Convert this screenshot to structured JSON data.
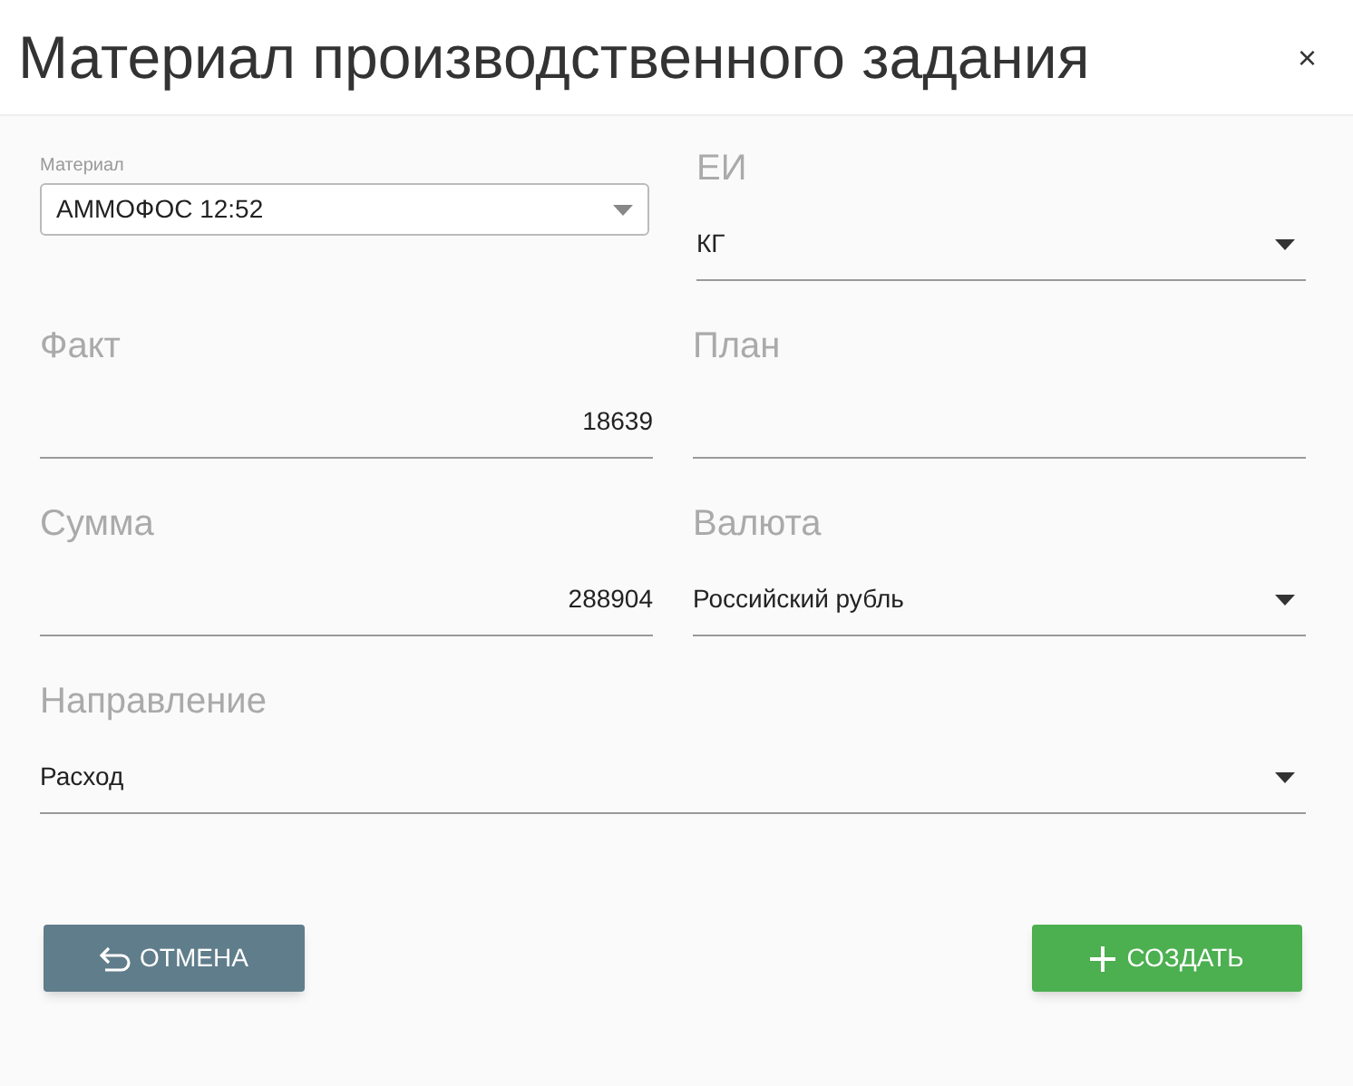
{
  "dialog": {
    "title": "Материал производственного задания",
    "close": "×"
  },
  "rows": [
    [
      {
        "kind": "boxed-select",
        "label": "Материал",
        "value": "АММОФОС 12:52"
      },
      {
        "kind": "select",
        "label": "ЕИ",
        "value": "КГ"
      }
    ],
    [
      {
        "kind": "number",
        "label": "Факт",
        "value": "18639"
      },
      {
        "kind": "number",
        "label": "План"
      }
    ],
    [
      {
        "kind": "number",
        "label": "Сумма",
        "value": "288904"
      },
      {
        "kind": "select",
        "label": "Валюта",
        "value": "Российский рубль"
      }
    ],
    [
      {
        "kind": "select",
        "label": "Направление",
        "value": "Расход"
      }
    ]
  ],
  "buttons": [
    {
      "kind": "cancel",
      "label": "ОТМЕНА"
    },
    {
      "kind": "create",
      "label": "СОЗДАТЬ"
    }
  ]
}
